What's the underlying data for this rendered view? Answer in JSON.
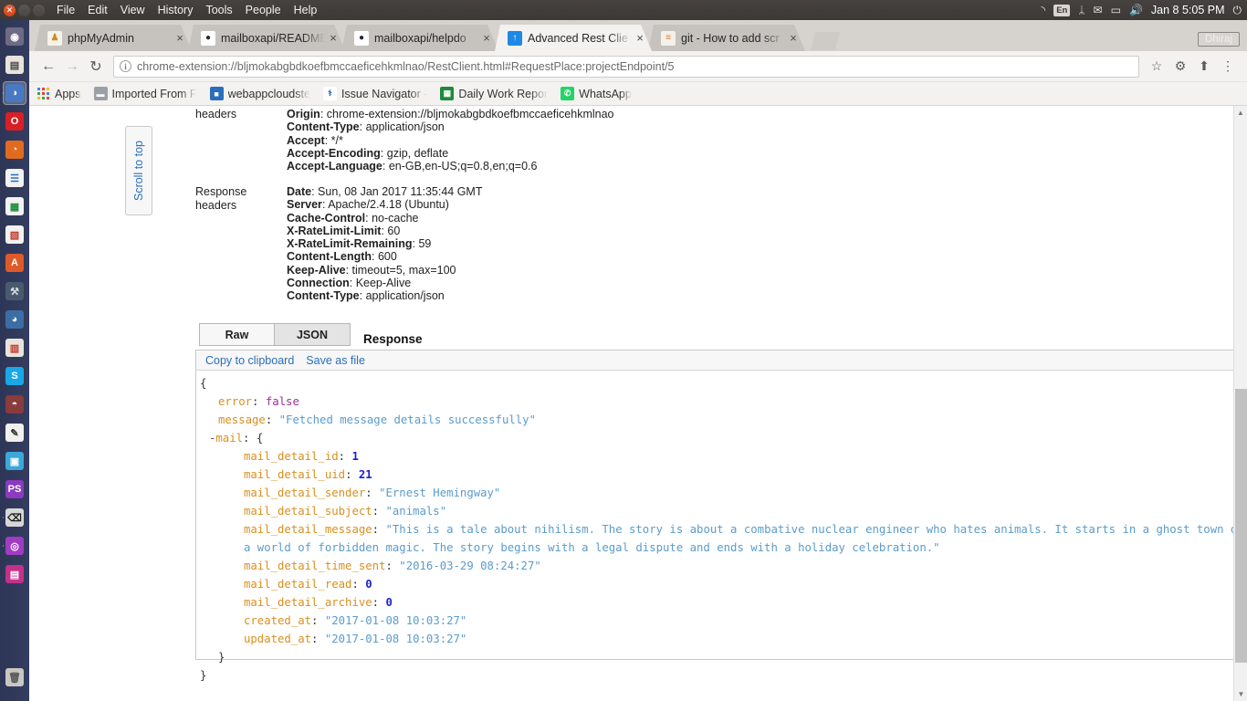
{
  "os_panel": {
    "window_buttons": [
      "close",
      "minimize",
      "maximize"
    ],
    "menus": [
      "File",
      "Edit",
      "View",
      "History",
      "Tools",
      "People",
      "Help"
    ],
    "indicators": [
      {
        "name": "wifi-icon",
        "glyph": "◝"
      },
      {
        "name": "keyboard-layout-indicator",
        "glyph": "En"
      },
      {
        "name": "bluetooth-icon",
        "glyph": "ᛦ"
      },
      {
        "name": "mail-icon",
        "glyph": "✉"
      },
      {
        "name": "battery-icon",
        "glyph": "▭"
      },
      {
        "name": "volume-icon",
        "glyph": "🔊"
      }
    ],
    "clock": "Jan 8 5:05 PM",
    "session_icon": "⏻"
  },
  "launcher": {
    "items": [
      {
        "name": "dash-home",
        "glyph": "◉",
        "color": "#6e6a84",
        "fg": "#ffffff",
        "active": false,
        "running": false
      },
      {
        "name": "files-nautilus",
        "glyph": "▤",
        "color": "#e8e4dc",
        "fg": "#4a4a4a",
        "active": false,
        "running": false
      },
      {
        "name": "chrome-browser",
        "glyph": "◑",
        "color": "#4a79c4",
        "fg": "#ffffff",
        "active": true,
        "running": true
      },
      {
        "name": "opera-browser",
        "glyph": "O",
        "color": "#d81f26",
        "fg": "#ffffff",
        "active": false,
        "running": false
      },
      {
        "name": "firefox-browser",
        "glyph": "◔",
        "color": "#e06b1f",
        "fg": "#ffffff",
        "active": false,
        "running": false
      },
      {
        "name": "libreoffice-writer",
        "glyph": "☰",
        "color": "#f2f2f2",
        "fg": "#2a6ebb",
        "active": false,
        "running": false
      },
      {
        "name": "libreoffice-calc",
        "glyph": "▦",
        "color": "#f2f2f2",
        "fg": "#1d8a3c",
        "active": false,
        "running": false
      },
      {
        "name": "libreoffice-impress",
        "glyph": "▧",
        "color": "#f2f2f2",
        "fg": "#c0392b",
        "active": false,
        "running": false
      },
      {
        "name": "ubuntu-software-center",
        "glyph": "A",
        "color": "#df5a28",
        "fg": "#ffffff",
        "active": false,
        "running": false
      },
      {
        "name": "system-settings",
        "glyph": "⚒",
        "color": "#4a5a6e",
        "fg": "#d8dde3",
        "active": false,
        "running": false
      },
      {
        "name": "help-icon",
        "glyph": "◕",
        "color": "#3c6ea5",
        "fg": "#ffffff",
        "active": false,
        "running": false
      },
      {
        "name": "amazon-shortcut",
        "glyph": "▥",
        "color": "#e8e4dc",
        "fg": "#c0392b",
        "active": false,
        "running": false
      },
      {
        "name": "skype",
        "glyph": "S",
        "color": "#1aa7e8",
        "fg": "#ffffff",
        "active": false,
        "running": false
      },
      {
        "name": "workspace-switcher",
        "glyph": "◓",
        "color": "#8a3b3b",
        "fg": "#ffffff",
        "active": false,
        "running": false
      },
      {
        "name": "text-editor-gedit",
        "glyph": "✎",
        "color": "#f0f0ee",
        "fg": "#333333",
        "active": false,
        "running": false
      },
      {
        "name": "archive-manager",
        "glyph": "▣",
        "color": "#3aa8d8",
        "fg": "#ffffff",
        "active": false,
        "running": false
      },
      {
        "name": "phpstorm",
        "glyph": "PS",
        "color": "#8a3bbf",
        "fg": "#ffffff",
        "active": false,
        "running": false
      },
      {
        "name": "terminal",
        "glyph": "⌫",
        "color": "#d8d8d8",
        "fg": "#1a1a1a",
        "active": false,
        "running": true
      },
      {
        "name": "mysql-workbench",
        "glyph": "◎",
        "color": "#a03bc4",
        "fg": "#ffffff",
        "active": false,
        "running": true
      },
      {
        "name": "window-app",
        "glyph": "▤",
        "color": "#c4308a",
        "fg": "#ffffff",
        "active": false,
        "running": false
      }
    ],
    "trash": {
      "name": "trash-icon",
      "glyph": "🗑",
      "color": "#c9c7c4",
      "fg": "#555555"
    }
  },
  "browser": {
    "tabs": [
      {
        "title": "phpMyAdmin",
        "favicon_name": "phpmyadmin-favicon",
        "favicon_glyph": "♟",
        "favicon_bg": "#f5f2ea",
        "favicon_fg": "#d08a24",
        "selected": false
      },
      {
        "title": "mailboxapi/README",
        "favicon_name": "github-favicon",
        "favicon_glyph": "●",
        "favicon_bg": "#ffffff",
        "favicon_fg": "#24292e",
        "selected": false
      },
      {
        "title": "mailboxapi/helpdo",
        "favicon_name": "github-favicon",
        "favicon_glyph": "●",
        "favicon_bg": "#ffffff",
        "favicon_fg": "#24292e",
        "selected": false
      },
      {
        "title": "Advanced Rest Clie",
        "favicon_name": "advanced-rest-client-favicon",
        "favicon_glyph": "↑",
        "favicon_bg": "#1e88e5",
        "favicon_fg": "#ffffff",
        "selected": true
      },
      {
        "title": "git - How to add scr",
        "favicon_name": "stackoverflow-favicon",
        "favicon_glyph": "≡",
        "favicon_bg": "#f5f0e8",
        "favicon_fg": "#e07b28",
        "selected": false
      }
    ],
    "new_tab_label": "",
    "profile_name": "Dhiraj",
    "nav": {
      "back": "←",
      "forward": "→",
      "reload": "↻"
    },
    "omnibox": {
      "info_glyph": "i",
      "url": "chrome-extension://bljmokabgbdkoefbmccaeficehkmlnao/RestClient.html#RequestPlace:projectEndpoint/5",
      "placeholder": "Search Google or type a URL"
    },
    "toolbar_icons": [
      {
        "name": "bookmark-star-icon",
        "glyph": "☆"
      },
      {
        "name": "gear-icon",
        "glyph": "⚙"
      },
      {
        "name": "extension-arc-icon",
        "glyph": "⬆"
      },
      {
        "name": "chrome-menu-icon",
        "glyph": "⋮"
      }
    ],
    "bookmarks": [
      {
        "label": "Apps",
        "icon_name": "apps-grid-icon",
        "glyph": "",
        "bg": "transparent",
        "fg": "#4a4a4a"
      },
      {
        "label": "Imported From F",
        "icon_name": "folder-icon",
        "glyph": "▬",
        "bg": "#9aa0a6",
        "fg": "#ffffff"
      },
      {
        "label": "webappcloudste",
        "icon_name": "webappcloud-favicon",
        "glyph": "■",
        "bg": "#2a6ebb",
        "fg": "#ffffff"
      },
      {
        "label": "Issue Navigator -",
        "icon_name": "jira-favicon",
        "glyph": "⚕",
        "bg": "#ffffff",
        "fg": "#2a6ebb"
      },
      {
        "label": "Daily Work Repor",
        "icon_name": "google-sheets-favicon",
        "glyph": "▦",
        "bg": "#1d8a3c",
        "fg": "#ffffff"
      },
      {
        "label": "WhatsApp",
        "icon_name": "whatsapp-favicon",
        "glyph": "✆",
        "bg": "#25d366",
        "fg": "#ffffff"
      }
    ]
  },
  "page": {
    "scroll_to_top_label": "Scroll to top",
    "request_headers": {
      "label": "headers",
      "rows": [
        {
          "key": "Origin",
          "value": "chrome-extension://bljmokabgbdkoefbmccaeficehkmlnao"
        },
        {
          "key": "Content-Type",
          "value": "application/json"
        },
        {
          "key": "Accept",
          "value": "*/*"
        },
        {
          "key": "Accept-Encoding",
          "value": "gzip, deflate"
        },
        {
          "key": "Accept-Language",
          "value": "en-GB,en-US;q=0.8,en;q=0.6"
        }
      ]
    },
    "response_headers": {
      "label_line1": "Response",
      "label_line2": "headers",
      "rows": [
        {
          "key": "Date",
          "value": "Sun, 08 Jan 2017 11:35:44 GMT"
        },
        {
          "key": "Server",
          "value": "Apache/2.4.18 (Ubuntu)"
        },
        {
          "key": "Cache-Control",
          "value": "no-cache"
        },
        {
          "key": "X-RateLimit-Limit",
          "value": "60"
        },
        {
          "key": "X-RateLimit-Remaining",
          "value": "59"
        },
        {
          "key": "Content-Length",
          "value": "600"
        },
        {
          "key": "Keep-Alive",
          "value": "timeout=5, max=100"
        },
        {
          "key": "Connection",
          "value": "Keep-Alive"
        },
        {
          "key": "Content-Type",
          "value": "application/json"
        }
      ]
    },
    "response_view": {
      "tabs": [
        {
          "label": "Raw",
          "selected": false
        },
        {
          "label": "JSON",
          "selected": true
        }
      ],
      "section_label": "Response",
      "actions": [
        {
          "label": "Copy to clipboard",
          "name": "copy-to-clipboard-link"
        },
        {
          "label": "Save as file",
          "name": "save-as-file-link"
        }
      ],
      "json": {
        "error": "false",
        "message": "Fetched message details successfully",
        "mail": {
          "mail_detail_id": "1",
          "mail_detail_uid": "21",
          "mail_detail_sender": "Ernest Hemingway",
          "mail_detail_subject": "animals",
          "mail_detail_message": "This is a tale about nihilism. The story is about a combative nuclear engineer who hates animals. It starts in a ghost town on a world of forbidden magic. The story begins with a legal dispute and ends with a holiday celebration.",
          "mail_detail_time_sent": "2016-03-29 08:24:27",
          "mail_detail_read": "0",
          "mail_detail_archive": "0",
          "created_at": "2017-01-08 10:03:27",
          "updated_at": "2017-01-08 10:03:27"
        }
      }
    }
  },
  "colors": {
    "json_key": "#d98f1f",
    "json_string": "#5a9ccc",
    "json_number": "#2020cc",
    "json_boolean": "#9b2d9b",
    "link": "#2a6ebb",
    "launcher_bg": "#303956",
    "panel_bg": "#3c3836"
  }
}
